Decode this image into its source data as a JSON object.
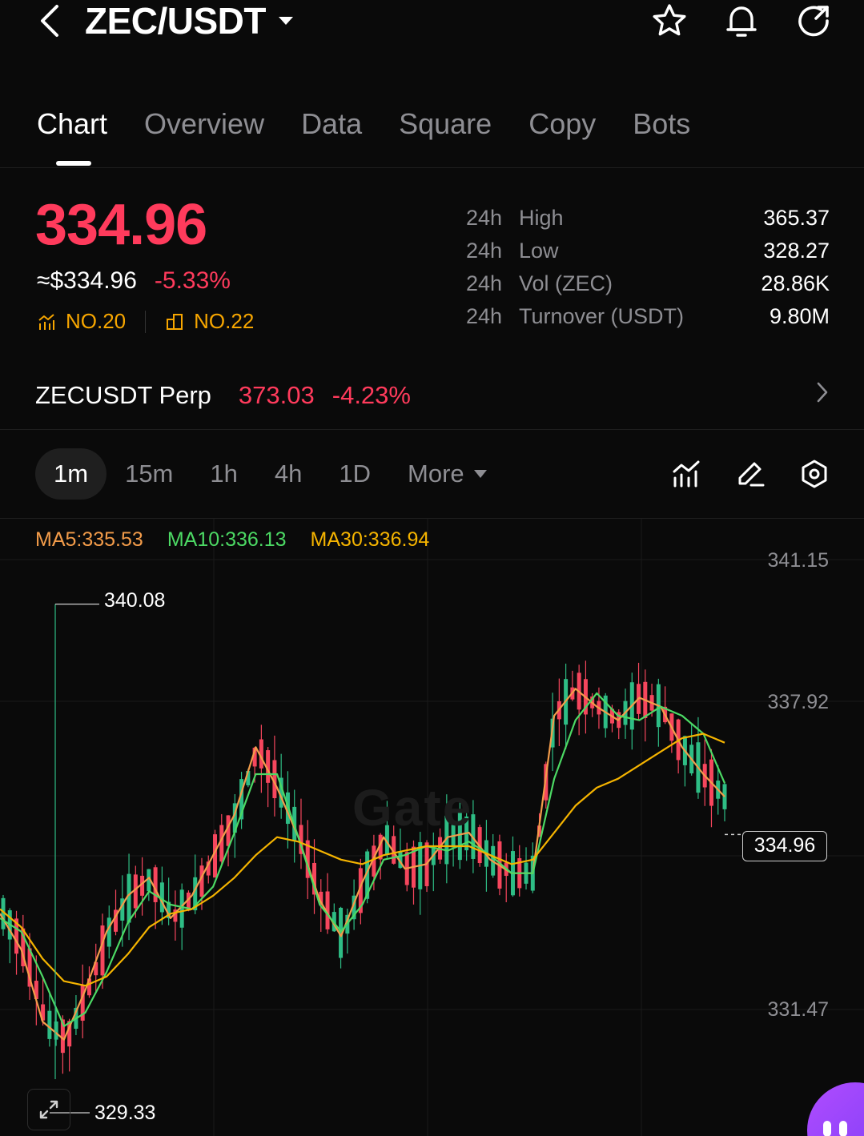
{
  "header": {
    "pair": "ZEC/USDT",
    "icons": [
      "back-chevron-icon",
      "star-icon",
      "bell-icon",
      "share-icon"
    ]
  },
  "tabs": [
    {
      "label": "Chart",
      "active": true
    },
    {
      "label": "Overview",
      "active": false
    },
    {
      "label": "Data",
      "active": false
    },
    {
      "label": "Square",
      "active": false
    },
    {
      "label": "Copy",
      "active": false
    },
    {
      "label": "Bots",
      "active": false
    }
  ],
  "price": {
    "last": "334.96",
    "usd": "≈$334.96",
    "change": "-5.33%",
    "rank_gain": "NO.20",
    "rank_volume": "NO.22"
  },
  "stats": [
    {
      "prefix": "24h",
      "label": "High",
      "value": "365.37"
    },
    {
      "prefix": "24h",
      "label": "Low",
      "value": "328.27"
    },
    {
      "prefix": "24h",
      "label": "Vol (ZEC)",
      "value": "28.86K"
    },
    {
      "prefix": "24h",
      "label": "Turnover (USDT)",
      "value": "9.80M"
    }
  ],
  "perp": {
    "name": "ZECUSDT Perp",
    "price": "373.03",
    "change": "-4.23%"
  },
  "intervals": {
    "items": [
      {
        "label": "1m",
        "active": true
      },
      {
        "label": "15m",
        "active": false
      },
      {
        "label": "1h",
        "active": false
      },
      {
        "label": "4h",
        "active": false
      },
      {
        "label": "1D",
        "active": false
      }
    ],
    "more": "More",
    "tools": [
      "indicator-icon",
      "draw-icon",
      "settings-icon"
    ]
  },
  "chart": {
    "ma5": "MA5:335.53",
    "ma10": "MA10:336.13",
    "ma30": "MA30:336.94",
    "axis": [
      "341.15",
      "337.92",
      "331.47"
    ],
    "high_marker": "340.08",
    "low_marker": "329.33",
    "current": "334.96",
    "watermark": "Gate",
    "colors": {
      "up": "#2ebd85",
      "down": "#f6465d",
      "ma5": "#f39c4a",
      "ma10": "#4cd964",
      "ma30": "#f5b400"
    }
  },
  "chart_data": {
    "type": "line",
    "title": "",
    "xlabel": "",
    "ylabel": "",
    "ylim": [
      329.0,
      341.5
    ],
    "y_ticks": [
      341.15,
      337.92,
      331.47
    ],
    "series": [
      {
        "name": "MA5",
        "values": [
          333.2,
          332.4,
          330.8,
          330.4,
          331.5,
          332.8,
          333.6,
          334.0,
          333.1,
          333.6,
          334.5,
          335.4,
          336.9,
          336.0,
          334.9,
          333.5,
          332.7,
          333.9,
          334.9,
          334.2,
          334.3,
          334.9,
          335.0,
          334.4,
          334.1,
          334.1,
          337.6,
          338.2,
          337.8,
          337.5,
          338.0,
          337.8,
          336.9,
          336.3,
          335.8
        ]
      },
      {
        "name": "MA10",
        "values": [
          333.1,
          332.8,
          331.8,
          330.7,
          331.0,
          331.9,
          333.0,
          333.7,
          333.4,
          333.3,
          333.8,
          335.0,
          336.3,
          336.3,
          334.9,
          333.4,
          332.8,
          333.4,
          334.4,
          334.5,
          334.7,
          334.6,
          334.8,
          334.5,
          334.1,
          334.1,
          336.2,
          337.5,
          338.1,
          337.6,
          337.5,
          337.8,
          337.6,
          337.2,
          336.1
        ]
      },
      {
        "name": "MA30",
        "values": [
          333.3,
          332.9,
          332.2,
          331.7,
          331.6,
          331.8,
          332.3,
          332.9,
          333.2,
          333.3,
          333.6,
          334.0,
          334.5,
          334.9,
          334.8,
          334.6,
          334.4,
          334.3,
          334.5,
          334.6,
          334.7,
          334.7,
          334.7,
          334.5,
          334.3,
          334.4,
          335.0,
          335.6,
          336.0,
          336.2,
          336.5,
          336.8,
          337.1,
          337.2,
          337.0
        ]
      }
    ],
    "high": 340.08,
    "low": 329.33,
    "last": 334.96
  }
}
